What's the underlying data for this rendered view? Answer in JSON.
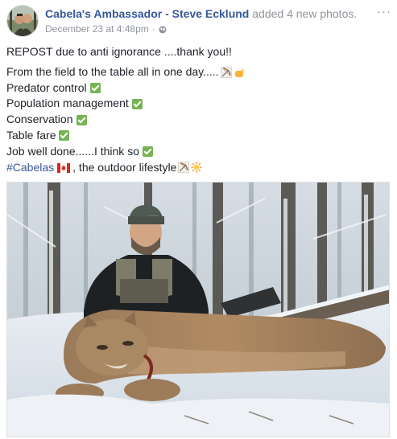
{
  "post": {
    "author_name": "Cabela's Ambassador - Steve Ecklund",
    "action_text": "added 4 new photos.",
    "timestamp": "December 23 at 4:48pm",
    "separator": "·",
    "options_label": "···"
  },
  "message": {
    "line1": "REPOST due to anti ignorance ....thank you!!",
    "line2": "From the field to the table all in one day.....",
    "line3": "Predator control",
    "line4": "Population management",
    "line5": "Conservation",
    "line6": "Table fare",
    "line7": "Job well done......I think so",
    "hashtag": "#Cabelas",
    "line8_rest": ", the outdoor lifestyle"
  },
  "icons": {
    "globe": "globe-icon",
    "check": "check-mark-icon",
    "bow": "bow-and-arrow-icon",
    "pointing": "pointing-hand-icon",
    "flag": "canada-flag-icon",
    "sun": "sun-icon",
    "options": "more-options-icon"
  },
  "colors": {
    "link_blue": "#365899",
    "meta_gray": "#90949c",
    "check_green": "#77b255",
    "text": "#1d2129"
  }
}
